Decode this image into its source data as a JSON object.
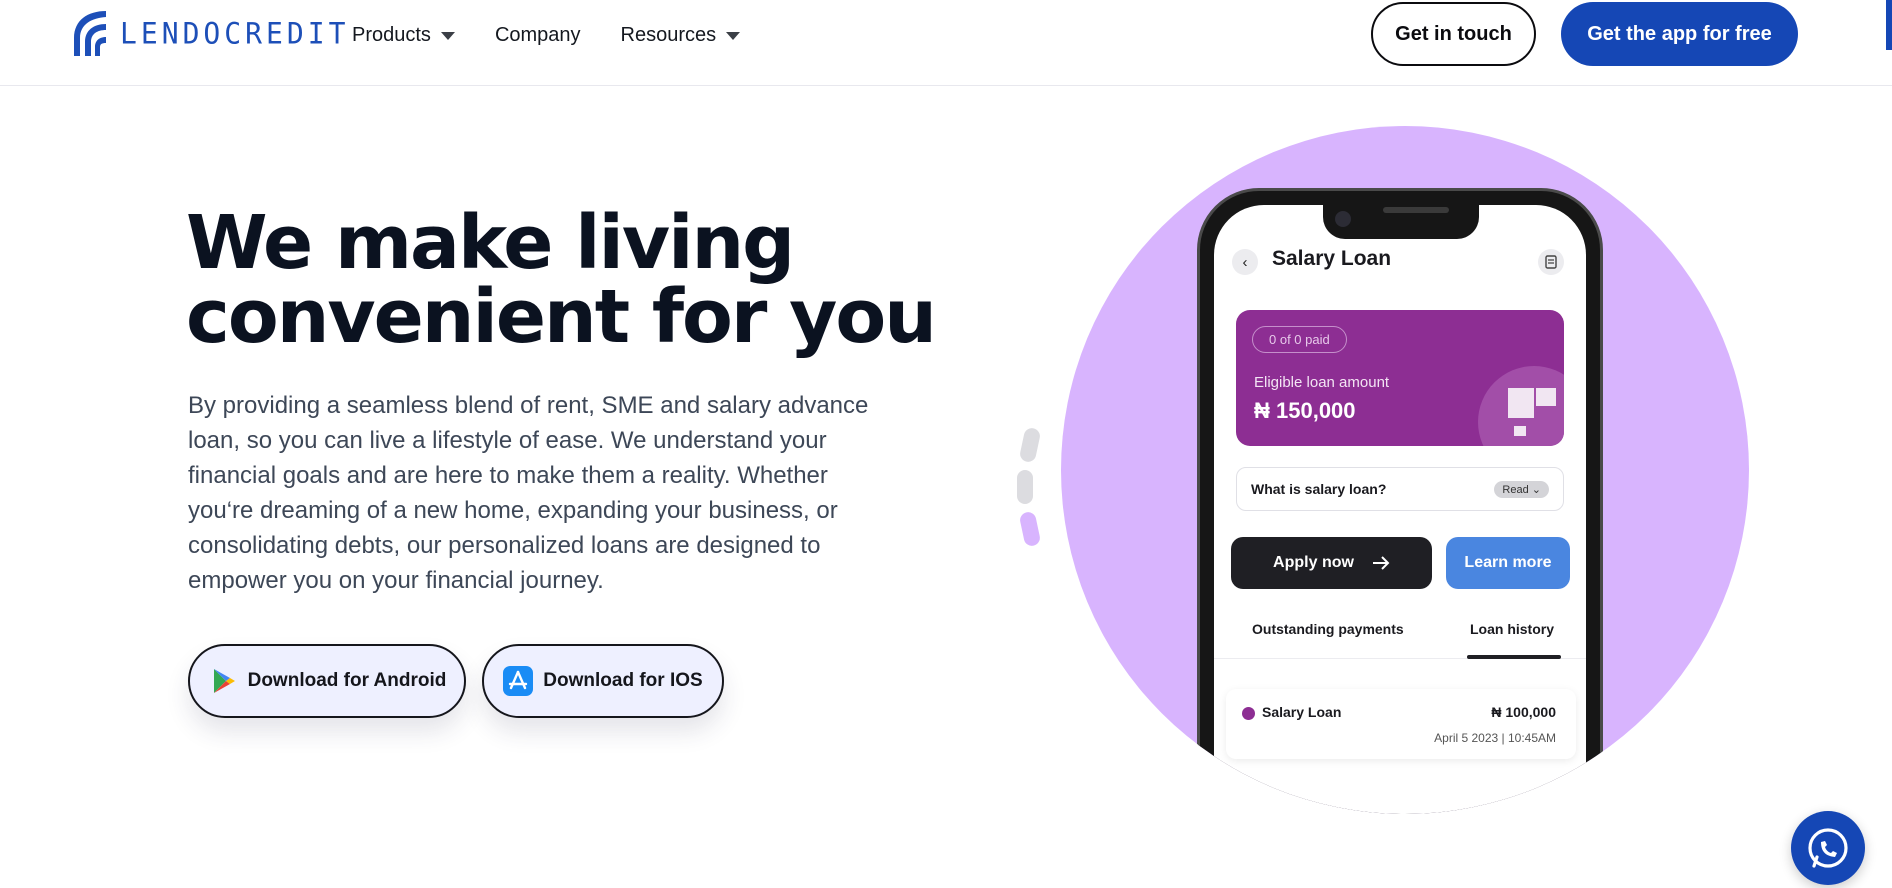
{
  "nav": {
    "logo_text": "LENDOCREDIT",
    "menu": [
      {
        "label": "Products",
        "has_dropdown": true
      },
      {
        "label": "Company",
        "has_dropdown": false
      },
      {
        "label": "Resources",
        "has_dropdown": true
      }
    ],
    "cta_secondary": "Get in touch",
    "cta_primary": "Get the app for free"
  },
  "hero": {
    "title_line1": "We make living",
    "title_line2": "convenient for you",
    "description": "By providing a seamless blend of rent, SME and salary advance loan, so you can live a lifestyle of ease. We understand your financial goals and are here to make them a reality. Whether you‘re dreaming of a new home, expanding your business, or consolidating debts, our personalized loans are designed to empower you on your financial journey.",
    "android_label": "Download for Android",
    "ios_label": "Download for IOS"
  },
  "phone": {
    "screen_title": "Salary Loan",
    "paid_status": "0 of 0 paid",
    "eligible_label": "Eligible loan amount",
    "eligible_amount": "₦ 150,000",
    "faq_question": "What is salary loan?",
    "faq_action": "Read",
    "apply_label": "Apply now",
    "learn_label": "Learn more",
    "tab_outstanding": "Outstanding payments",
    "tab_history": "Loan history",
    "payment": {
      "name": "Salary Loan",
      "amount": "₦ 100,000",
      "date": "April 5 2023  |  10:45AM"
    }
  },
  "colors": {
    "brand_blue": "#1547b5",
    "accent_purple": "#d8b4fe",
    "card_purple": "#8d2e93",
    "learn_blue": "#4a86e0"
  },
  "icons": {
    "whatsapp": "whatsapp-icon",
    "android": "google-play-icon",
    "ios": "app-store-icon"
  }
}
